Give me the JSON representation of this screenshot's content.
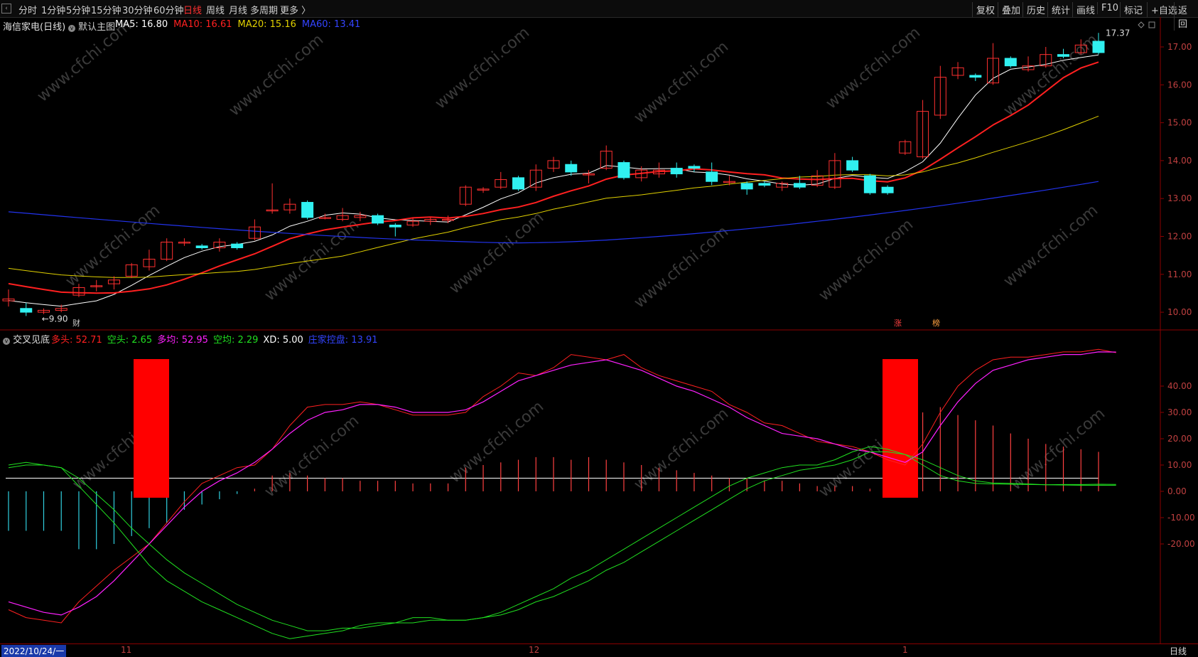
{
  "toolbar": {
    "periods": [
      "分时",
      "1分钟",
      "5分钟",
      "15分钟",
      "30分钟",
      "60分钟",
      "日线",
      "周线",
      "月线",
      "多周期",
      "更多 〉"
    ],
    "active_period": "日线",
    "right_buttons": [
      "复权",
      "叠加",
      "历史",
      "统计",
      "画线",
      "F10",
      "标记",
      "+自选",
      "返回"
    ]
  },
  "main_chart": {
    "stock_name": "海信家电(日线)",
    "template": "默认主图",
    "ma": [
      {
        "label": "MA5: 16.80",
        "color": "#ffffff"
      },
      {
        "label": "MA10: 16.61",
        "color": "#ff2020"
      },
      {
        "label": "MA20: 15.16",
        "color": "#e0d000"
      },
      {
        "label": "MA60: 13.41",
        "color": "#3344ff"
      }
    ],
    "price_axis": [
      "17.00",
      "16.00",
      "15.00",
      "14.00",
      "13.00",
      "12.00",
      "11.00",
      "10.00"
    ],
    "high_label": "17.37",
    "low_label": "9.90",
    "markers": [
      "财",
      "涨",
      "榜"
    ]
  },
  "indicator": {
    "name": "交叉见底",
    "values": [
      {
        "label": "多头: 52.71",
        "color": "#ff2020"
      },
      {
        "label": "空头: 2.65",
        "color": "#20e020"
      },
      {
        "label": "多均: 52.95",
        "color": "#ff20ff"
      },
      {
        "label": "空均: 2.29",
        "color": "#20e020"
      },
      {
        "label": "XD: 5.00",
        "color": "#ffffff"
      },
      {
        "label": "庄家控盘: 13.91",
        "color": "#3344ff"
      }
    ],
    "axis": [
      "40.00",
      "30.00",
      "20.00",
      "10.00",
      "0.00",
      "-10.00",
      "-20.00"
    ]
  },
  "time_axis": {
    "labels": [
      "2022/10/24/一",
      "11",
      "12",
      "1"
    ],
    "period_label": "日线"
  },
  "watermark": "www.cfchi.com",
  "chart_data": {
    "type": "candlestick",
    "title": "海信家电(日线)",
    "xlabel": "",
    "ylabel": "",
    "ylim": [
      9.75,
      17.5
    ],
    "x_ticks": [
      "2022/10/24",
      "11",
      "12",
      "1"
    ],
    "candles": [
      [
        10.3,
        10.35,
        10.15,
        10.6
      ],
      [
        10.1,
        10.0,
        9.9,
        10.25
      ],
      [
        10.0,
        10.05,
        9.95,
        10.1
      ],
      [
        10.05,
        10.1,
        10.0,
        10.2
      ],
      [
        10.45,
        10.65,
        10.4,
        10.75
      ],
      [
        10.7,
        10.7,
        10.55,
        10.85
      ],
      [
        10.75,
        10.85,
        10.6,
        10.95
      ],
      [
        10.95,
        11.25,
        10.9,
        11.3
      ],
      [
        11.2,
        11.4,
        11.1,
        11.65
      ],
      [
        11.4,
        11.85,
        11.35,
        11.95
      ],
      [
        11.85,
        11.85,
        11.75,
        11.95
      ],
      [
        11.75,
        11.7,
        11.65,
        11.8
      ],
      [
        11.7,
        11.85,
        11.6,
        11.95
      ],
      [
        11.8,
        11.7,
        11.65,
        11.85
      ],
      [
        11.95,
        12.25,
        11.9,
        12.45
      ],
      [
        12.7,
        12.7,
        12.6,
        13.4
      ],
      [
        12.7,
        12.85,
        12.6,
        13.0
      ],
      [
        12.9,
        12.5,
        12.45,
        12.95
      ],
      [
        12.5,
        12.5,
        12.45,
        12.6
      ],
      [
        12.45,
        12.55,
        12.4,
        12.75
      ],
      [
        12.5,
        12.55,
        12.4,
        12.65
      ],
      [
        12.55,
        12.35,
        12.3,
        12.6
      ],
      [
        12.3,
        12.25,
        12.0,
        12.35
      ],
      [
        12.3,
        12.4,
        12.25,
        12.5
      ],
      [
        12.4,
        12.45,
        12.3,
        12.5
      ],
      [
        12.45,
        12.45,
        12.35,
        12.55
      ],
      [
        12.85,
        13.3,
        12.8,
        13.35
      ],
      [
        13.25,
        13.25,
        13.15,
        13.3
      ],
      [
        13.3,
        13.5,
        13.25,
        13.7
      ],
      [
        13.55,
        13.25,
        13.2,
        13.6
      ],
      [
        13.3,
        13.75,
        13.2,
        13.9
      ],
      [
        13.8,
        14.0,
        13.7,
        14.1
      ],
      [
        13.9,
        13.7,
        13.6,
        14.0
      ],
      [
        13.65,
        13.65,
        13.4,
        13.75
      ],
      [
        13.8,
        14.25,
        13.75,
        14.4
      ],
      [
        13.95,
        13.55,
        13.5,
        14.0
      ],
      [
        13.55,
        13.75,
        13.45,
        13.85
      ],
      [
        13.65,
        13.75,
        13.55,
        13.95
      ],
      [
        13.8,
        13.65,
        13.55,
        13.95
      ],
      [
        13.85,
        13.8,
        13.7,
        13.9
      ],
      [
        13.7,
        13.45,
        13.35,
        13.95
      ],
      [
        13.45,
        13.45,
        13.35,
        13.6
      ],
      [
        13.4,
        13.25,
        13.1,
        13.45
      ],
      [
        13.4,
        13.35,
        13.3,
        13.45
      ],
      [
        13.3,
        13.4,
        13.2,
        13.45
      ],
      [
        13.4,
        13.3,
        13.25,
        13.6
      ],
      [
        13.35,
        13.6,
        13.3,
        13.75
      ],
      [
        13.3,
        14.0,
        13.25,
        14.2
      ],
      [
        14.0,
        13.75,
        13.7,
        14.1
      ],
      [
        13.6,
        13.15,
        13.1,
        13.65
      ],
      [
        13.3,
        13.15,
        13.1,
        13.35
      ],
      [
        14.2,
        14.5,
        14.15,
        14.55
      ],
      [
        14.1,
        15.3,
        14.05,
        15.6
      ],
      [
        15.2,
        16.2,
        15.1,
        16.5
      ],
      [
        16.25,
        16.45,
        16.15,
        16.6
      ],
      [
        16.25,
        16.2,
        16.1,
        16.3
      ],
      [
        16.05,
        16.7,
        16.0,
        17.1
      ],
      [
        16.7,
        16.5,
        16.45,
        16.75
      ],
      [
        16.4,
        16.5,
        16.35,
        16.75
      ],
      [
        16.5,
        16.8,
        16.45,
        17.0
      ],
      [
        16.8,
        16.75,
        16.7,
        16.95
      ],
      [
        16.85,
        17.05,
        16.8,
        17.2
      ],
      [
        17.15,
        16.85,
        16.8,
        17.37
      ]
    ]
  }
}
